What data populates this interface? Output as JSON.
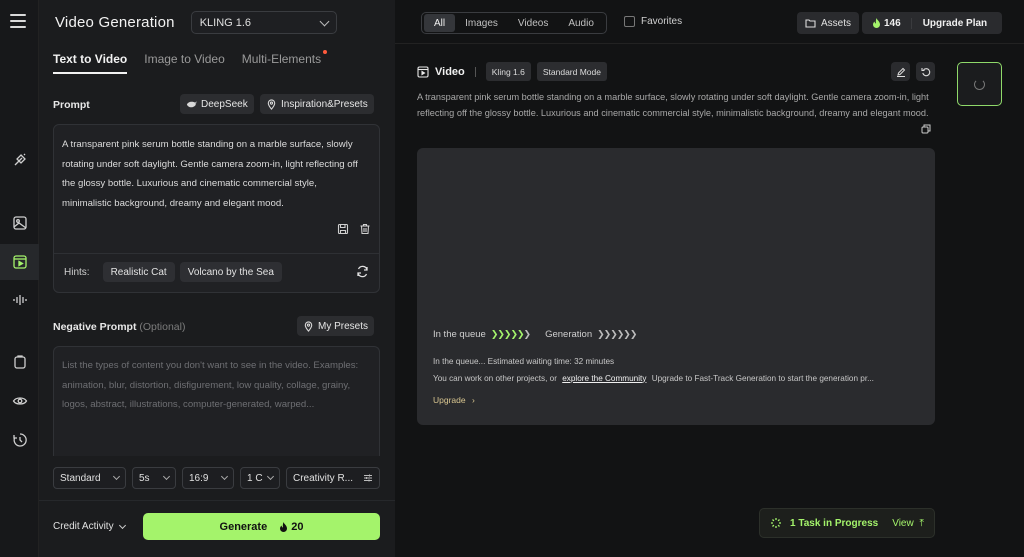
{
  "sidebar": {
    "icons": [
      "menu-icon",
      "magic-wand-icon",
      "image-icon",
      "video-icon",
      "audio-icon",
      "bag-icon",
      "eye-icon",
      "history-icon"
    ]
  },
  "panel": {
    "title": "Video Generation",
    "model": "KLING 1.6",
    "tabs": [
      {
        "label": "Text to Video"
      },
      {
        "label": "Image to Video"
      },
      {
        "label": "Multi-Elements"
      }
    ],
    "prompt_label": "Prompt",
    "deepseek_label": "DeepSeek",
    "inspiration_label": "Inspiration&Presets",
    "prompt_text": "A transparent pink serum bottle standing on a marble surface, slowly rotating under soft daylight. Gentle camera zoom-in, light reflecting off the glossy bottle. Luxurious and cinematic commercial style, minimalistic background, dreamy and elegant mood.",
    "hints_label": "Hints:",
    "hints": [
      "Realistic Cat",
      "Volcano by the Sea"
    ],
    "negative_label": "Negative Prompt",
    "negative_optional": "(Optional)",
    "my_presets_label": "My Presets",
    "negative_placeholder": "List the types of content you don't want to see in the video. Examples: animation, blur, distortion, disfigurement, low quality, collage, grainy, logos, abstract, illustrations, computer-generated, warped...",
    "options": {
      "mode": "Standard",
      "duration": "5s",
      "ratio": "16:9",
      "count": "1 C",
      "creativity": "Creativity R..."
    },
    "credit_activity": "Credit Activity",
    "generate_label": "Generate",
    "generate_cost": "20"
  },
  "topbar": {
    "filters": [
      "All",
      "Images",
      "Videos",
      "Audio"
    ],
    "favorites_label": "Favorites",
    "assets_label": "Assets",
    "credits": "146",
    "upgrade_plan": "Upgrade Plan"
  },
  "video": {
    "title": "Video",
    "model_tag": "Kling 1.6",
    "mode_tag": "Standard Mode",
    "description": "A transparent pink serum bottle standing on a marble surface, slowly rotating under soft daylight. Gentle camera zoom-in, light reflecting off the glossy bottle. Luxurious and cinematic commercial style, minimalistic background, dreamy and elegant mood.",
    "queue_label": "In the queue",
    "generation_label": "Generation",
    "queue_wait": "In the queue... Estimated waiting time: 32 minutes",
    "queue_other_prefix": "You can work on other projects, or",
    "community_link": "explore the Community",
    "queue_other_suffix": "Upgrade to Fast-Track Generation to start the generation pr...",
    "upgrade_link": "Upgrade"
  },
  "toast": {
    "task_label": "1 Task in Progress",
    "view_label": "View"
  }
}
